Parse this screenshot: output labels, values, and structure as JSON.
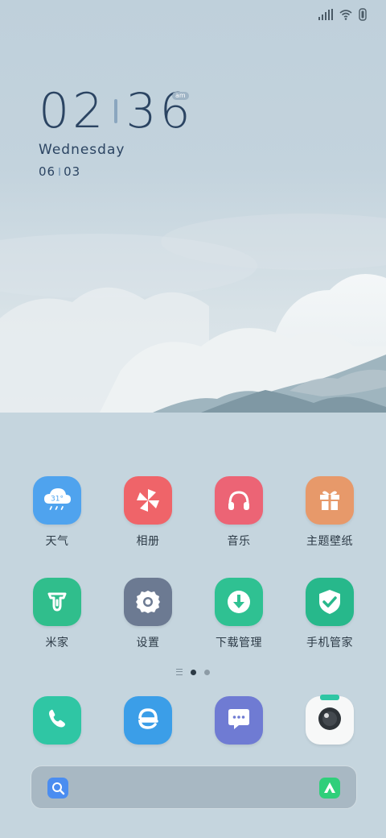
{
  "status_bar": {
    "signal_icon": "signal-icon",
    "wifi_icon": "wifi-icon",
    "battery_icon": "battery-icon"
  },
  "clock": {
    "hour": "02",
    "minute": "36",
    "ampm": "am",
    "weekday": "Wednesday",
    "month": "06",
    "day": "03"
  },
  "apps": [
    {
      "label": "天气",
      "icon": "weather-icon",
      "color": "#4fa3ee",
      "temp": "31°"
    },
    {
      "label": "相册",
      "icon": "pinwheel-icon",
      "color": "#ef6469"
    },
    {
      "label": "音乐",
      "icon": "headphones-icon",
      "color": "#ec6475"
    },
    {
      "label": "主题壁纸",
      "icon": "gift-icon",
      "color": "#e7996a"
    },
    {
      "label": "米家",
      "icon": "mijia-icon",
      "color": "#30be8c"
    },
    {
      "label": "设置",
      "icon": "gear-icon",
      "color": "#6c7a92"
    },
    {
      "label": "下载管理",
      "icon": "download-icon",
      "color": "#2fc192"
    },
    {
      "label": "手机管家",
      "icon": "shield-icon",
      "color": "#27b88b"
    }
  ],
  "page_indicator": {
    "pages": 2,
    "current": 1
  },
  "dock": [
    {
      "name": "phone",
      "icon": "phone-icon",
      "color": "#2fc6a4"
    },
    {
      "name": "browser",
      "icon": "browser-icon",
      "color": "#3b9ee8"
    },
    {
      "name": "messages",
      "icon": "message-icon",
      "color": "#6f7bd3"
    },
    {
      "name": "camera",
      "icon": "camera-icon",
      "color": "#f7f8f8"
    }
  ],
  "search": {
    "search_icon": "search-icon",
    "assistant_icon": "assistant-icon"
  }
}
